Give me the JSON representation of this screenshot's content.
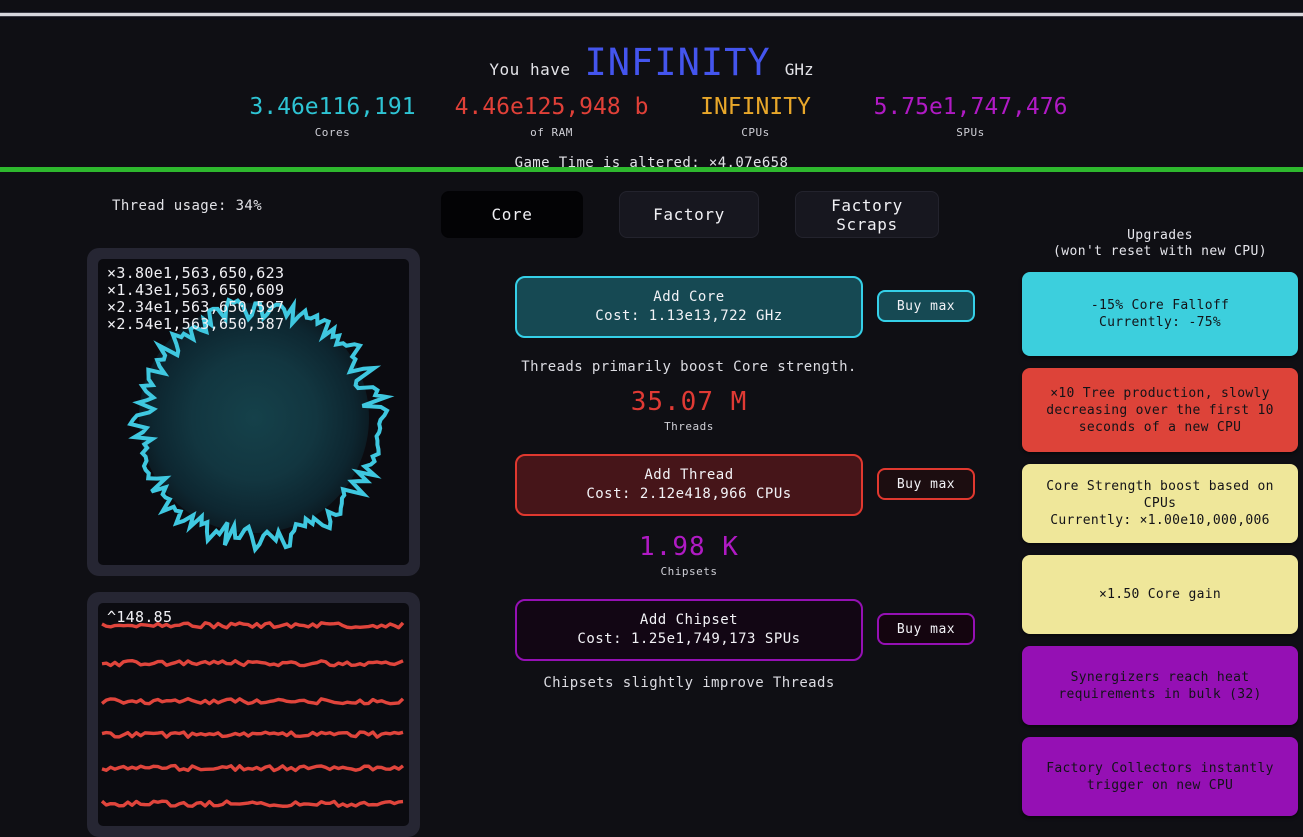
{
  "header": {
    "have_label": "You have",
    "have_value": "INFINITY",
    "have_unit": "GHz",
    "stats": [
      {
        "value": "3.46e116,191",
        "name": "Cores",
        "color": "#2ec4d4"
      },
      {
        "value": "4.46e125,948 b",
        "name": "of RAM",
        "color": "#e04038"
      },
      {
        "value": "INFINITY",
        "name": "CPUs",
        "color": "#e8a72a"
      },
      {
        "value": "5.75e1,747,476",
        "name": "SPUs",
        "color": "#b01ac4"
      }
    ],
    "game_time": "Game Time is altered: ×4.07e658"
  },
  "left": {
    "thread_usage": "Thread usage: 34%",
    "circle_panel": {
      "overlay_lines": [
        "×3.80e1,563,650,623",
        "×1.43e1,563,650,609",
        "×2.34e1,563,650,597",
        "×2.54e1,563,650,587"
      ],
      "trace_color": "#3fc8e0"
    },
    "lines_panel": {
      "overlay_label": "^148.85",
      "trace_color": "#e0453c",
      "line_count": 6
    }
  },
  "tabs": [
    {
      "id": "core",
      "label": "Core",
      "active": true
    },
    {
      "id": "factory",
      "label": "Factory",
      "active": false
    },
    {
      "id": "scraps",
      "label": "Factory\nScraps",
      "active": false
    }
  ],
  "main": {
    "core": {
      "button_title": "Add Core",
      "button_cost": "Cost: 1.13e13,722 GHz",
      "buy_max": "Buy max"
    },
    "threads": {
      "hint": "Threads primarily boost Core strength.",
      "amount": "35.07 M",
      "name": "Threads",
      "button_title": "Add Thread",
      "button_cost": "Cost: 2.12e418,966 CPUs",
      "buy_max": "Buy max"
    },
    "chipsets": {
      "amount": "1.98 K",
      "name": "Chipsets",
      "button_title": "Add Chipset",
      "button_cost": "Cost: 1.25e1,749,173 SPUs",
      "buy_max": "Buy max",
      "hint": "Chipsets slightly improve Threads"
    }
  },
  "upgrades": {
    "title_line1": "Upgrades",
    "title_line2": "(won't reset with new CPU)",
    "items": [
      {
        "text": "-15% Core Falloff\nCurrently: -75%",
        "color": "#3ccfdd",
        "size": "h1"
      },
      {
        "text": "×10 Tree production, slowly decreasing over the first 10 seconds of a new CPU",
        "color": "#dd4339",
        "size": "h1"
      },
      {
        "text": "Core Strength boost based on CPUs\nCurrently: ×1.00e10,000,006",
        "color": "#efe79a",
        "size": "h2"
      },
      {
        "text": "×1.50 Core gain",
        "color": "#efe79a",
        "size": "h2"
      },
      {
        "text": "Synergizers reach heat requirements in bulk (32)",
        "color": "#9510b4",
        "size": "h2"
      },
      {
        "text": "Factory Collectors instantly trigger on new CPU",
        "color": "#9510b4",
        "size": "h2"
      }
    ]
  },
  "chart_data": [
    {
      "type": "line",
      "name": "radial-core-trace",
      "title": "",
      "render": "polar",
      "points": 180,
      "base_radius": 0.62,
      "noise": 0.09,
      "color": "#3fc8e0",
      "annotations": [
        "×3.80e1,563,650,623",
        "×1.43e1,563,650,609",
        "×2.34e1,563,650,597",
        "×2.54e1,563,650,587"
      ]
    },
    {
      "type": "line",
      "name": "resource-history-lines",
      "title": "",
      "render": "cartesian",
      "ylabel": "",
      "xlabel": "",
      "peak_label": "^148.85",
      "series_count": 6,
      "series_baselines": [
        0.9,
        0.73,
        0.56,
        0.41,
        0.26,
        0.1
      ],
      "color": "#e0453c",
      "grid": false
    }
  ],
  "colors": {
    "background": "#0f0f14",
    "divider_green": "#2eb82e",
    "accent_blue": "#4455ee",
    "panel_frame": "#262633",
    "panel_canvas": "#0b0b10"
  }
}
